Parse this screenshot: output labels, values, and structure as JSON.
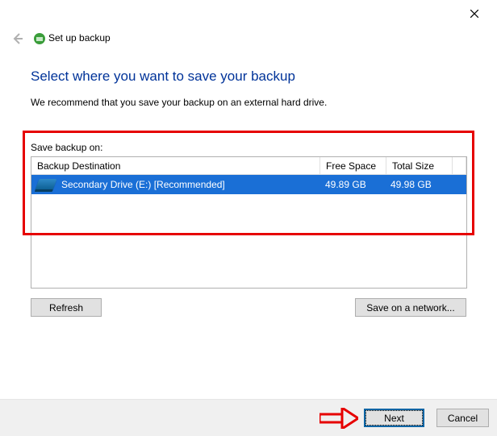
{
  "window": {
    "title": "Set up backup"
  },
  "heading": "Select where you want to save your backup",
  "subheading": "We recommend that you save your backup on an external hard drive.",
  "save_label": "Save backup on:",
  "columns": {
    "dest": "Backup Destination",
    "free": "Free Space",
    "total": "Total Size"
  },
  "destinations": [
    {
      "name": "Secondary Drive (E:) [Recommended]",
      "free": "49.89 GB",
      "total": "49.98 GB",
      "selected": true
    }
  ],
  "buttons": {
    "refresh": "Refresh",
    "network": "Save on a network...",
    "next": "Next",
    "cancel": "Cancel"
  }
}
